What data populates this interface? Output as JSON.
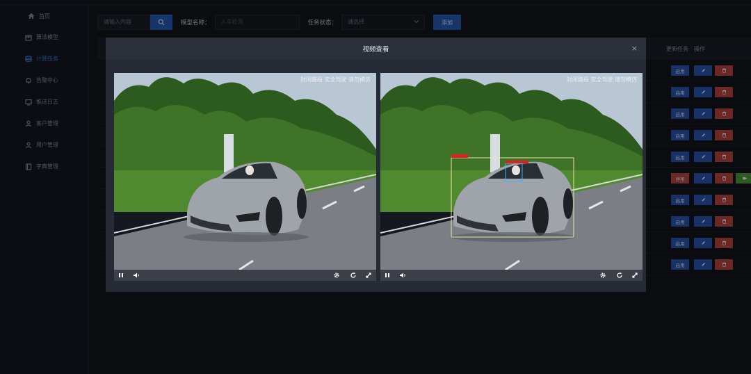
{
  "sidebar": {
    "items": [
      {
        "label": "首页",
        "icon": "home-icon"
      },
      {
        "label": "算法模型",
        "icon": "package-icon"
      },
      {
        "label": "计算任务",
        "icon": "database-icon",
        "active": true
      },
      {
        "label": "告警中心",
        "icon": "bell-icon"
      },
      {
        "label": "推送日志",
        "icon": "monitor-icon"
      },
      {
        "label": "客户管理",
        "icon": "user-icon"
      },
      {
        "label": "用户管理",
        "icon": "user-icon"
      },
      {
        "label": "字典管理",
        "icon": "book-icon"
      }
    ]
  },
  "toolbar": {
    "search_placeholder": "请输入内容",
    "model_label": "模型名称：",
    "model_placeholder": "人车检测",
    "status_label": "任务状态：",
    "status_placeholder": "请选择",
    "add_label": "添加"
  },
  "table": {
    "headers": [
      "更新任务",
      "操作"
    ],
    "rows": [
      {
        "first": "启用"
      },
      {
        "first": "启用"
      },
      {
        "first": "启用"
      },
      {
        "first": "启用"
      },
      {
        "first": "启用"
      },
      {
        "first": "停用",
        "view": true
      },
      {
        "first": "启用"
      },
      {
        "first": "启用"
      },
      {
        "first": "启用"
      },
      {
        "first": "启用"
      }
    ]
  },
  "modal": {
    "title": "视频查看",
    "close": "×",
    "watermark": "封闭路段 安全驾驶 请勿模仿"
  },
  "colors": {
    "primary": "#2a5cb8",
    "danger": "#b8453f",
    "success": "#4f9a3c",
    "active_nav": "#3c7be0"
  }
}
